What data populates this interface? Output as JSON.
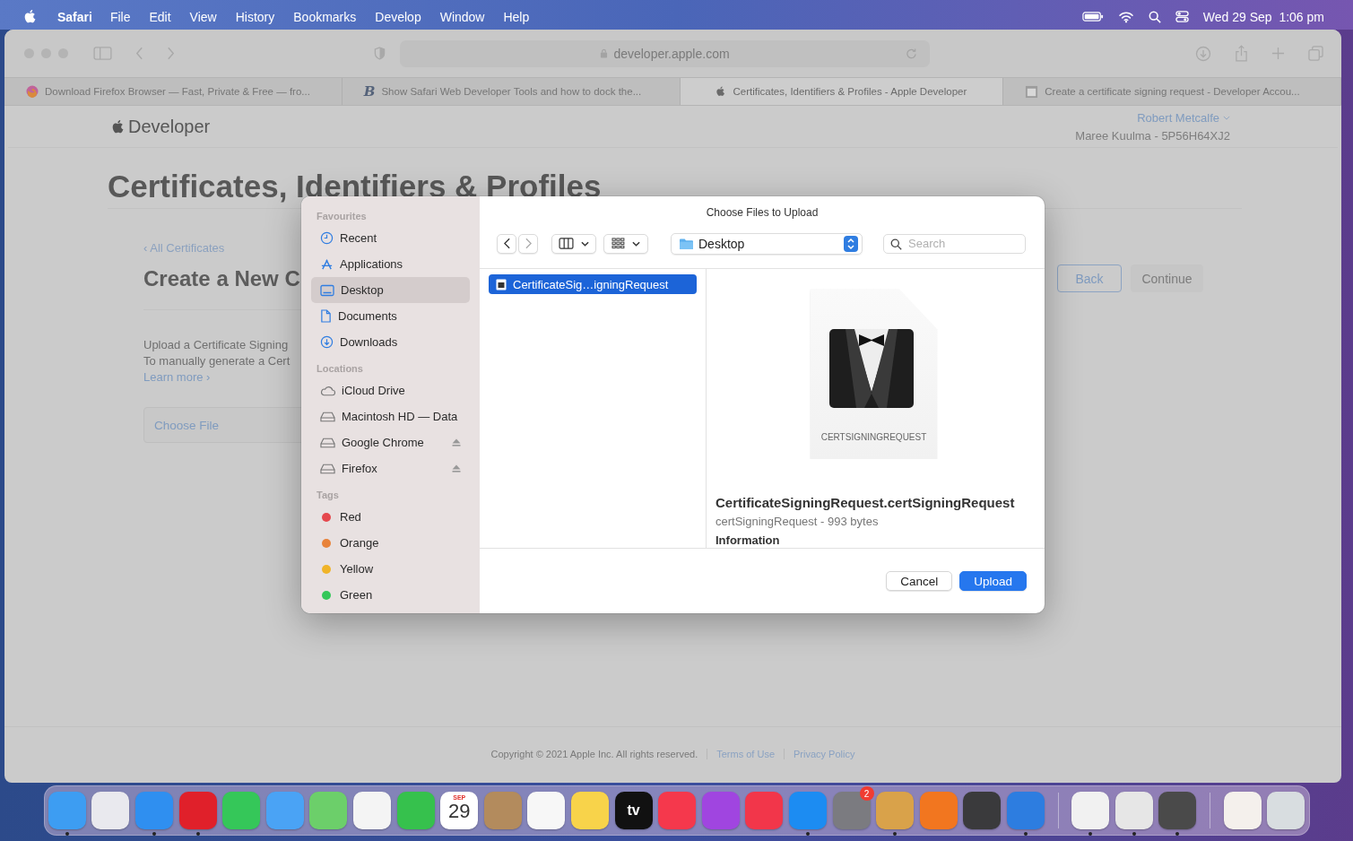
{
  "menu_bar": {
    "app": "Safari",
    "items": [
      "File",
      "Edit",
      "View",
      "History",
      "Bookmarks",
      "Develop",
      "Window",
      "Help"
    ],
    "clock": "Wed 29 Sep  1:06 pm"
  },
  "browser": {
    "address": "developer.apple.com",
    "tabs": [
      {
        "kind": "fox",
        "title": "Download Firefox Browser — Fast, Private & Free — fro...",
        "selected": false
      },
      {
        "kind": "letter",
        "icon_text": "B",
        "title": "Show Safari Web Developer Tools and how to dock the...",
        "selected": false
      },
      {
        "kind": "apple",
        "title": "Certificates, Identifiers & Profiles - Apple Developer",
        "selected": true
      },
      {
        "kind": "page",
        "title": "Create a certificate signing request - Developer Accou...",
        "selected": false
      }
    ]
  },
  "page": {
    "brand": "Developer",
    "account_name": "Robert Metcalfe",
    "team": "Maree Kuulma - 5P56H64XJ2",
    "title": "Certificates, Identifiers & Profiles",
    "back_link": "‹ All Certificates",
    "heading": "Create a New C",
    "lines": [
      "Upload a Certificate Signing",
      "To manually generate a Cert"
    ],
    "learn_more": "Learn more ›",
    "choose_file": "Choose File",
    "buttons": [
      {
        "label": "Back",
        "disabled": false
      },
      {
        "label": "Continue",
        "disabled": true
      }
    ],
    "footer": {
      "copyright": "Copyright © 2021 Apple Inc. All rights reserved.",
      "links": [
        "Terms of Use",
        "Privacy Policy"
      ]
    }
  },
  "dialog": {
    "title": "Choose Files to Upload",
    "sidebar": [
      {
        "heading": "Favourites",
        "items": [
          {
            "label": "Recent",
            "kind": "clock",
            "selected": false,
            "eject": false
          },
          {
            "label": "Applications",
            "kind": "apps",
            "selected": false,
            "eject": false
          },
          {
            "label": "Desktop",
            "kind": "desktop",
            "selected": true,
            "eject": false
          },
          {
            "label": "Documents",
            "kind": "document",
            "selected": false,
            "eject": false
          },
          {
            "label": "Downloads",
            "kind": "download",
            "selected": false,
            "eject": false
          }
        ]
      },
      {
        "heading": "Locations",
        "items": [
          {
            "label": "iCloud Drive",
            "kind": "cloud",
            "selected": false,
            "eject": false
          },
          {
            "label": "Macintosh HD — Data",
            "kind": "disk",
            "selected": false,
            "eject": false
          },
          {
            "label": "Google Chrome",
            "kind": "disk",
            "selected": false,
            "eject": true
          },
          {
            "label": "Firefox",
            "kind": "disk",
            "selected": false,
            "eject": true
          }
        ]
      },
      {
        "heading": "Tags",
        "items": [
          {
            "label": "Red",
            "kind": "tag",
            "color": "#e5484d",
            "selected": false,
            "eject": false
          },
          {
            "label": "Orange",
            "kind": "tag",
            "color": "#e8833a",
            "selected": false,
            "eject": false
          },
          {
            "label": "Yellow",
            "kind": "tag",
            "color": "#f0b429",
            "selected": false,
            "eject": false
          },
          {
            "label": "Green",
            "kind": "tag",
            "color": "#34c759",
            "selected": false,
            "eject": false
          }
        ]
      }
    ],
    "location": "Desktop",
    "search_placeholder": "Search",
    "files": [
      {
        "name": "CertificateSig…igningRequest",
        "selected": true
      }
    ],
    "preview": {
      "type_label": "CERTSIGNINGREQUEST",
      "name": "CertificateSigningRequest.certSigningRequest",
      "meta": "certSigningRequest - 993 bytes",
      "section": "Information"
    },
    "buttons": [
      {
        "label": "Cancel",
        "default": false
      },
      {
        "label": "Upload",
        "default": true
      }
    ]
  },
  "dock": [
    {
      "kind": "app",
      "color": "#3d9df2",
      "running": true
    },
    {
      "kind": "app",
      "color": "#e9e9ee",
      "running": false
    },
    {
      "kind": "app",
      "color": "#2f8ff0",
      "running": true
    },
    {
      "kind": "app",
      "color": "#e0202a",
      "running": true
    },
    {
      "kind": "app",
      "color": "#35c759",
      "running": false
    },
    {
      "kind": "app",
      "color": "#4aa3f5",
      "running": false
    },
    {
      "kind": "app",
      "color": "#6ccf6a",
      "running": false
    },
    {
      "kind": "app",
      "color": "#f4f4f4",
      "running": false
    },
    {
      "kind": "app",
      "color": "#36c14d",
      "running": false
    },
    {
      "kind": "calendar",
      "color": "#ffffff",
      "month": "SEP",
      "day": "29",
      "running": false
    },
    {
      "kind": "app",
      "color": "#b38b5d",
      "running": false
    },
    {
      "kind": "app",
      "color": "#f7f7f7",
      "running": false
    },
    {
      "kind": "app",
      "color": "#f8d34a",
      "running": false
    },
    {
      "kind": "label",
      "color": "#111111",
      "text": "tv",
      "running": false
    },
    {
      "kind": "app",
      "color": "#f5384c",
      "running": false
    },
    {
      "kind": "app",
      "color": "#a045e0",
      "running": false
    },
    {
      "kind": "app",
      "color": "#f2364a",
      "running": false
    },
    {
      "kind": "app",
      "color": "#1c8cf2",
      "running": true
    },
    {
      "kind": "app",
      "color": "#7b7b80",
      "badge": "2",
      "running": false
    },
    {
      "kind": "app",
      "color": "#d9a24a",
      "running": true
    },
    {
      "kind": "app",
      "color": "#f2761f",
      "running": false
    },
    {
      "kind": "app",
      "color": "#3a3a3c",
      "running": false
    },
    {
      "kind": "app",
      "color": "#2d7de0",
      "running": true
    },
    {
      "kind": "separator"
    },
    {
      "kind": "app",
      "color": "#f1f1f1",
      "running": true
    },
    {
      "kind": "app",
      "color": "#e6e6e6",
      "running": true
    },
    {
      "kind": "app",
      "color": "#4a4a4a",
      "running": true
    },
    {
      "kind": "separator"
    },
    {
      "kind": "app",
      "color": "#f4f0ec",
      "running": false
    },
    {
      "kind": "app",
      "color": "#d8dde0",
      "running": false
    }
  ]
}
